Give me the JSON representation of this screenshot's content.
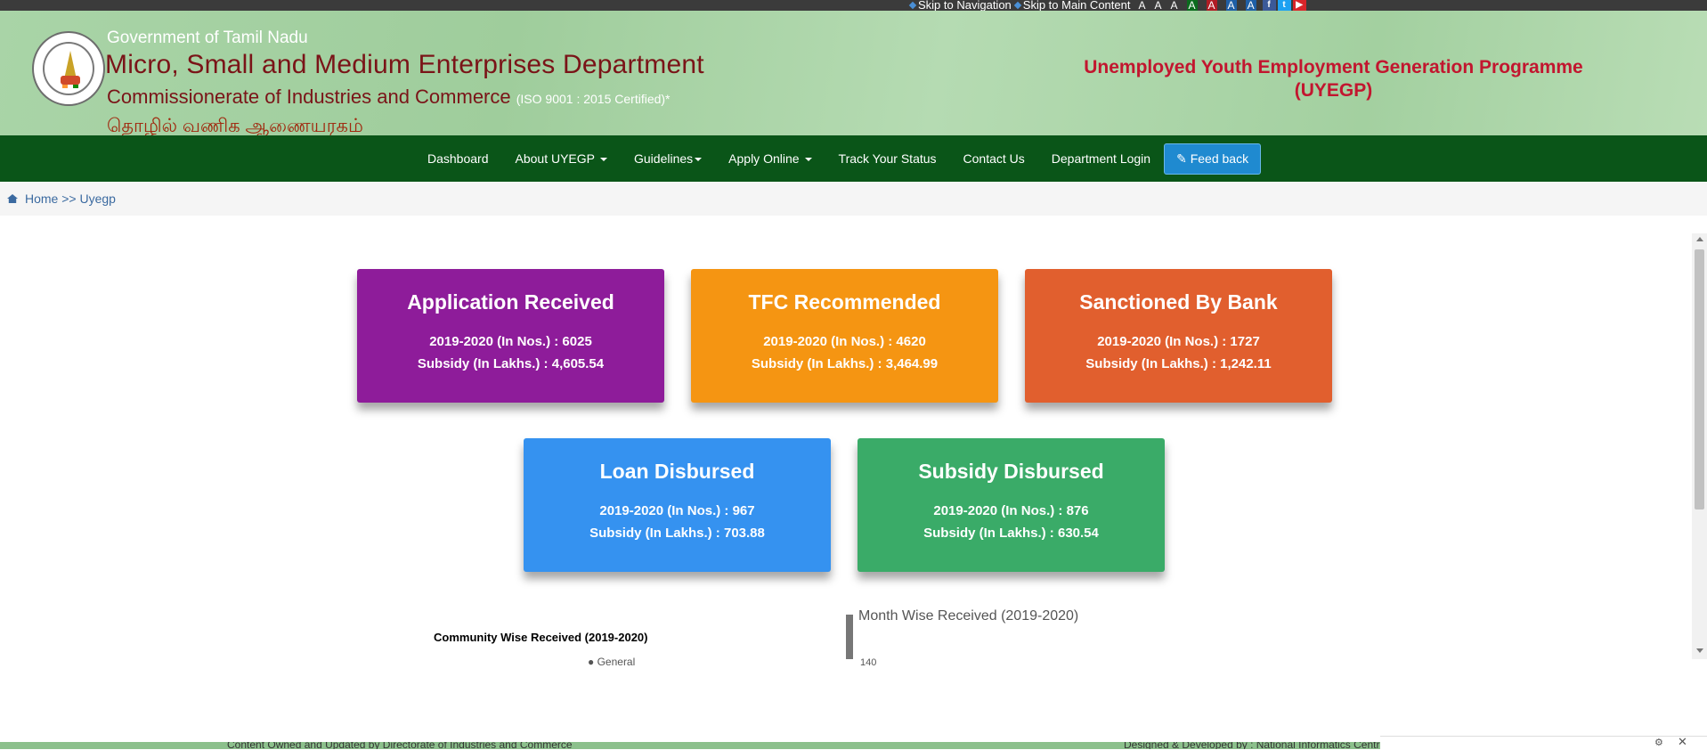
{
  "topbar": {
    "skip_nav": "Skip to Navigation",
    "skip_main": "Skip to Main Content",
    "font_sizes": [
      "A",
      "A",
      "A",
      "A",
      "A",
      "A",
      "A"
    ],
    "social": [
      "facebook-icon",
      "twitter-icon",
      "youtube-icon"
    ]
  },
  "header": {
    "gov": "Government of Tamil Nadu",
    "dept": "Micro, Small and Medium Enterprises Department",
    "comm": "Commissionerate of Industries and Commerce",
    "iso": "(ISO 9001 : 2015 Certified)*",
    "tamil": "தொழில் வணிக ஆணையரகம்",
    "program_line1": "Unemployed Youth Employment Generation Programme",
    "program_line2": "(UYEGP)"
  },
  "nav": {
    "dashboard": "Dashboard",
    "about": "About UYEGP",
    "guidelines": "Guidelines",
    "apply": "Apply Online",
    "track": "Track Your Status",
    "contact": "Contact Us",
    "login": "Department Login",
    "feedback": "Feed back"
  },
  "breadcrumb": "Home >> Uyegp",
  "cards": [
    {
      "title": "Application Received",
      "count_line": "2019-2020  (In Nos.) :  6025",
      "subsidy_line": "Subsidy (In Lakhs.) : 4,605.54",
      "color": "#8e1c9a"
    },
    {
      "title": "TFC Recommended",
      "count_line": "2019-2020  (In Nos.) :  4620",
      "subsidy_line": "Subsidy (In Lakhs.) : 3,464.99",
      "color": "#f59512"
    },
    {
      "title": "Sanctioned By Bank",
      "count_line": "2019-2020  (In Nos.) :  1727",
      "subsidy_line": "Subsidy (In Lakhs.) : 1,242.11",
      "color": "#e15f2e"
    },
    {
      "title": "Loan Disbursed",
      "count_line": "2019-2020  (In Nos.) : 967",
      "subsidy_line": "Subsidy (In Lakhs.) : 703.88",
      "color": "#3592f0"
    },
    {
      "title": "Subsidy Disbursed",
      "count_line": "2019-2020  (In Nos.) : 876",
      "subsidy_line": "Subsidy (In Lakhs.) : 630.54",
      "color": "#3aab68"
    }
  ],
  "charts": {
    "community_title": "Community Wise Received (2019-2020)",
    "community_legend": "● General",
    "month_title": "Month Wise Received (2019-2020)",
    "month_tick": "140"
  },
  "footer": {
    "left": "Content Owned and Updated by Directorate of Industries and Commerce",
    "right": "Designed & Developed by : National Informatics Centre"
  }
}
